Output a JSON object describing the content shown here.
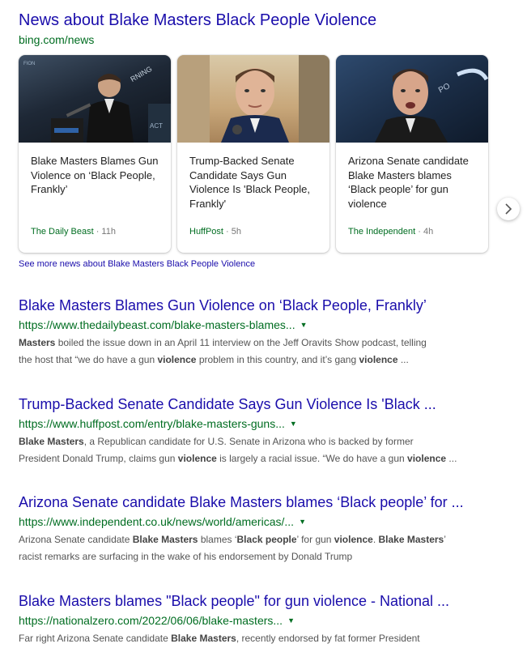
{
  "news": {
    "title": "News about Blake Masters Black People Violence",
    "url": "bing.com/news",
    "cards": [
      {
        "title": "Blake Masters Blames Gun Violence on ‘Black People, Frankly’",
        "source": "The Daily Beast",
        "age": " · 11h"
      },
      {
        "title": "Trump-Backed Senate Candidate Says Gun Violence Is 'Black People, Frankly'",
        "source": "HuffPost",
        "age": " · 5h"
      },
      {
        "title": "Arizona Senate candidate Blake Masters blames ‘Black people’ for gun violence",
        "source": "The Independent",
        "age": " · 4h"
      }
    ],
    "see_more": "See more news about Blake Masters Black People Violence"
  },
  "results": [
    {
      "title": "Blake Masters Blames Gun Violence on ‘Black People, Frankly’",
      "url": "https://www.thedailybeast.com/blake-masters-blames...",
      "snippet1": [
        {
          "t": "Masters",
          "b": true
        },
        {
          "t": " boiled the issue down in an April 11 interview on the Jeff Oravits Show podcast, telling",
          "b": false
        }
      ],
      "snippet2": [
        {
          "t": "the host that “we do have a gun ",
          "b": false
        },
        {
          "t": "violence",
          "b": true
        },
        {
          "t": " problem in this country, and it’s gang ",
          "b": false
        },
        {
          "t": "violence",
          "b": true
        },
        {
          "t": " ...",
          "b": false
        }
      ]
    },
    {
      "title": "Trump-Backed Senate Candidate Says Gun Violence Is 'Black ...",
      "url": "https://www.huffpost.com/entry/blake-masters-guns...",
      "snippet1": [
        {
          "t": "Blake Masters",
          "b": true
        },
        {
          "t": ", a Republican candidate for U.S. Senate in Arizona who is backed by former",
          "b": false
        }
      ],
      "snippet2": [
        {
          "t": "President Donald Trump, claims gun ",
          "b": false
        },
        {
          "t": "violence",
          "b": true
        },
        {
          "t": " is largely a racial issue. “We do have a gun ",
          "b": false
        },
        {
          "t": "violence",
          "b": true
        },
        {
          "t": " ...",
          "b": false
        }
      ]
    },
    {
      "title": "Arizona Senate candidate Blake Masters blames ‘Black people’ for ...",
      "url": "https://www.independent.co.uk/news/world/americas/...",
      "snippet1": [
        {
          "t": "Arizona Senate candidate ",
          "b": false
        },
        {
          "t": "Blake Masters",
          "b": true
        },
        {
          "t": " blames ‘",
          "b": false
        },
        {
          "t": "Black people",
          "b": true
        },
        {
          "t": "’ for gun ",
          "b": false
        },
        {
          "t": "violence",
          "b": true
        },
        {
          "t": ". ",
          "b": false
        },
        {
          "t": "Blake Masters",
          "b": true
        },
        {
          "t": "’",
          "b": false
        }
      ],
      "snippet2": [
        {
          "t": "racist remarks are surfacing in the wake of his endorsement by Donald Trump",
          "b": false
        }
      ]
    },
    {
      "title": "Blake Masters blames \"Black people\" for gun violence - National ...",
      "url": "https://nationalzero.com/2022/06/06/blake-masters...",
      "snippet1": [
        {
          "t": "Far right Arizona Senate candidate ",
          "b": false
        },
        {
          "t": "Blake Masters",
          "b": true
        },
        {
          "t": ", recently endorsed by fat former President",
          "b": false
        }
      ],
      "snippet2": []
    }
  ],
  "icons": {
    "carousel_next": "chevron-right-icon",
    "url_dropdown": "caret-down-icon"
  },
  "colors": {
    "link": "#1a0dab",
    "url": "#006d21",
    "snippet": "#545454"
  }
}
